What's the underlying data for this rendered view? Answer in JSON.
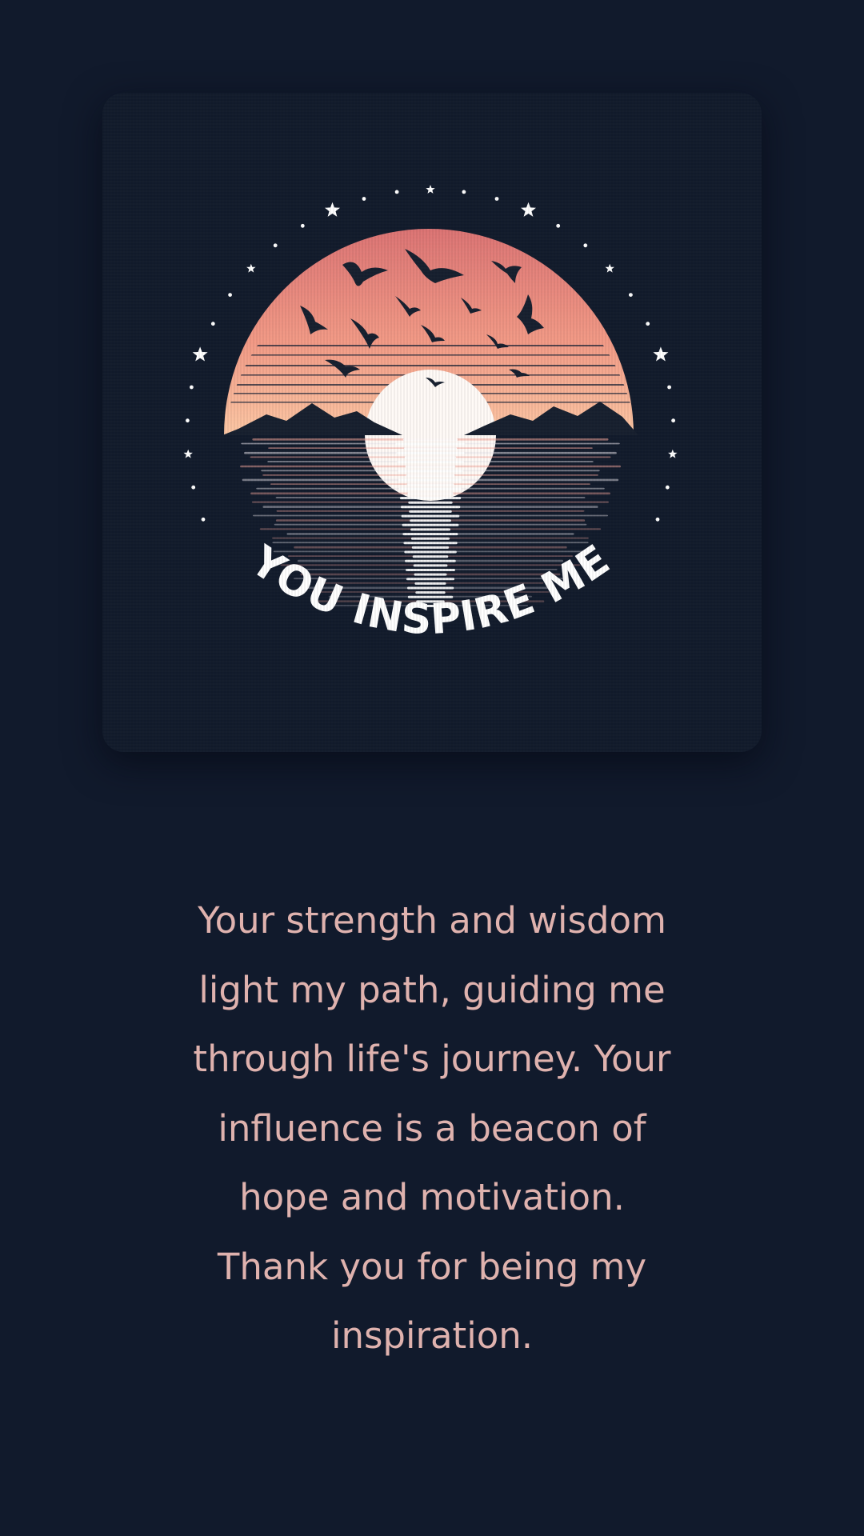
{
  "colors": {
    "background": "#111a2c",
    "card": "#121b2c",
    "sunset_top": "#de7774",
    "sunset_bottom": "#fbc6a5",
    "message_text": "#dfb2ae",
    "logo_text": "#ffffff"
  },
  "artwork": {
    "logo_text": "YOU INSPIRE ME"
  },
  "message": {
    "lines": [
      "Your strength and wisdom",
      "light my path, guiding me",
      "through life's journey. Your",
      "influence is a beacon of",
      "hope and motivation.",
      "Thank you for being my",
      "inspiration."
    ]
  }
}
